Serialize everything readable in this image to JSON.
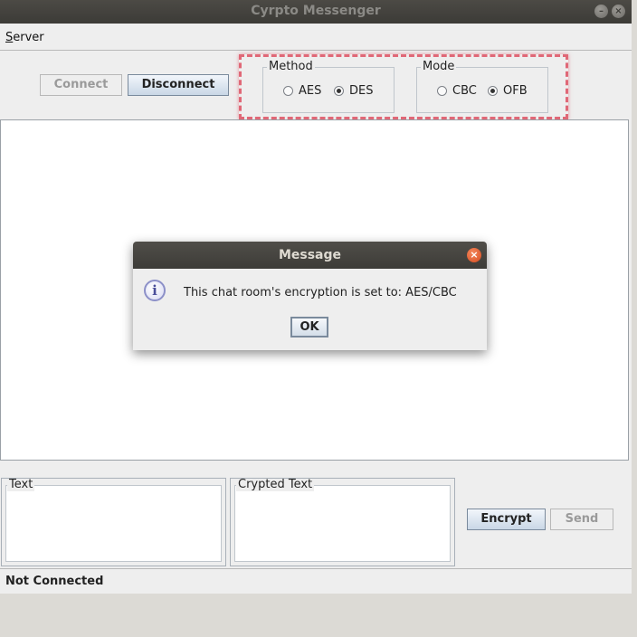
{
  "window": {
    "title": "Cyrpto Messenger",
    "min_glyph": "–",
    "close_glyph": "×"
  },
  "menubar": {
    "server_mnemonic": "S",
    "server_rest": "erver"
  },
  "toolbar": {
    "connect_label": "Connect",
    "disconnect_label": "Disconnect"
  },
  "method": {
    "legend": "Method",
    "options": [
      {
        "label": "AES",
        "selected": false
      },
      {
        "label": "DES",
        "selected": true
      }
    ]
  },
  "mode": {
    "legend": "Mode",
    "options": [
      {
        "label": "CBC",
        "selected": false
      },
      {
        "label": "OFB",
        "selected": true
      }
    ]
  },
  "panels": {
    "text_legend": "Text",
    "crypted_legend": "Crypted Text"
  },
  "actions": {
    "encrypt_label": "Encrypt",
    "send_label": "Send"
  },
  "status": {
    "text": "Not Connected"
  },
  "dialog": {
    "title": "Message",
    "icon_glyph": "i",
    "close_glyph": "×",
    "message": "This chat room's encryption is set to: AES/CBC",
    "ok_label": "OK"
  },
  "colors": {
    "highlight": "#dc3c50",
    "title_bar": "#3c3b37",
    "close_button": "#e05a2b"
  }
}
